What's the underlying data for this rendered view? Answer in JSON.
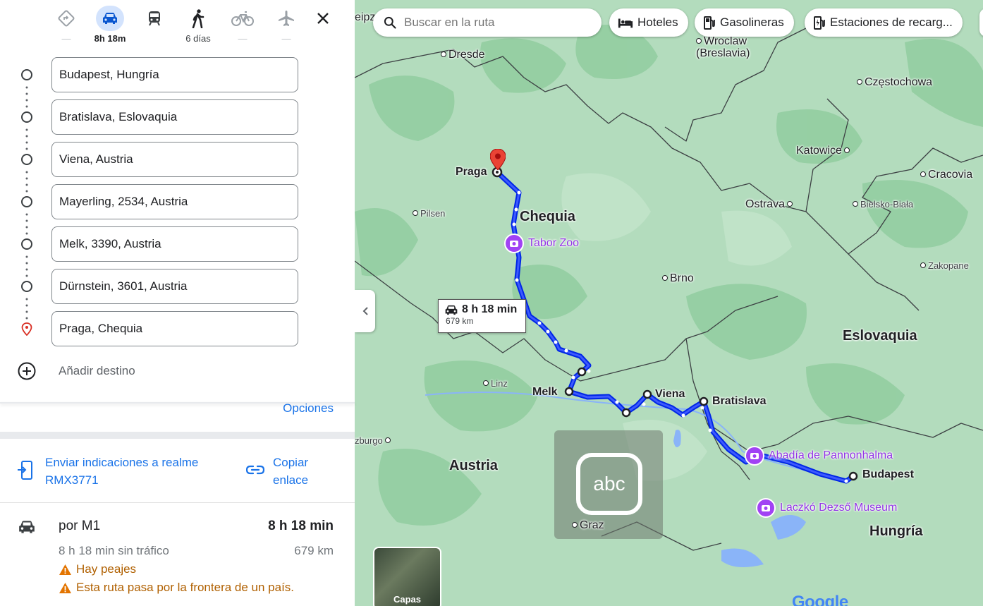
{
  "modes": {
    "best": {
      "label": "—"
    },
    "car": {
      "label": "8h 18m"
    },
    "transit": {
      "label": ""
    },
    "walk": {
      "label": "6 días"
    },
    "bike": {
      "label": "—"
    },
    "flight": {
      "label": "—"
    }
  },
  "waypoints": [
    {
      "value": "Budapest, Hungría"
    },
    {
      "value": "Bratislava, Eslovaquia"
    },
    {
      "value": "Viena, Austria"
    },
    {
      "value": "Mayerling, 2534, Austria"
    },
    {
      "value": "Melk, 3390, Austria"
    },
    {
      "value": "Dürnstein, 3601, Austria"
    },
    {
      "value": "Praga, Chequia"
    }
  ],
  "add_destination": "Añadir destino",
  "options_label": "Opciones",
  "send": {
    "label": "Enviar indicaciones a realme RMX3771"
  },
  "copy": {
    "label": "Copiar enlace"
  },
  "route": {
    "via": "por M1",
    "time": "8 h 18 min",
    "no_traffic": "8 h 18 min sin tráfico",
    "distance": "679 km",
    "warnings": [
      "Hay peajes",
      "Esta ruta pasa por la frontera de un país."
    ]
  },
  "map": {
    "search_placeholder": "Buscar en la ruta",
    "chips": [
      "Hoteles",
      "Gasolineras",
      "Estaciones de recarg..."
    ],
    "badge_time": "8 h 18 min",
    "badge_distance": "679 km",
    "layers_label": "Capas",
    "abc_label": "abc",
    "brand": "Google",
    "route_color": "#1a1aff",
    "places": {
      "leipzig": "eipz",
      "dresden": "Dresde",
      "wroclaw": "Wroclaw\n(Breslavia)",
      "czestochowa": "Częstochowa",
      "katowice": "Katowice",
      "cracovia": "Cracovia",
      "bielsko": "Bielsko-Biała",
      "zakopane": "Zakopane",
      "ostrava": "Ostrava",
      "praga": "Praga",
      "chequia": "Chequia",
      "pilsen": "Pilsen",
      "tabor": "Tabor Zoo",
      "brno": "Brno",
      "eslovaquia": "Eslovaquia",
      "linz": "Linz",
      "melk": "Melk",
      "viena": "Viena",
      "bratislava": "Bratislava",
      "salzburgo": "zburgo",
      "austria": "Austria",
      "pannonhalma": "Abadía de Pannonhalma",
      "budapest": "Budapest",
      "laczko": "Laczkó Dezső Museum",
      "hungria": "Hungría",
      "graz": "Graz"
    }
  }
}
